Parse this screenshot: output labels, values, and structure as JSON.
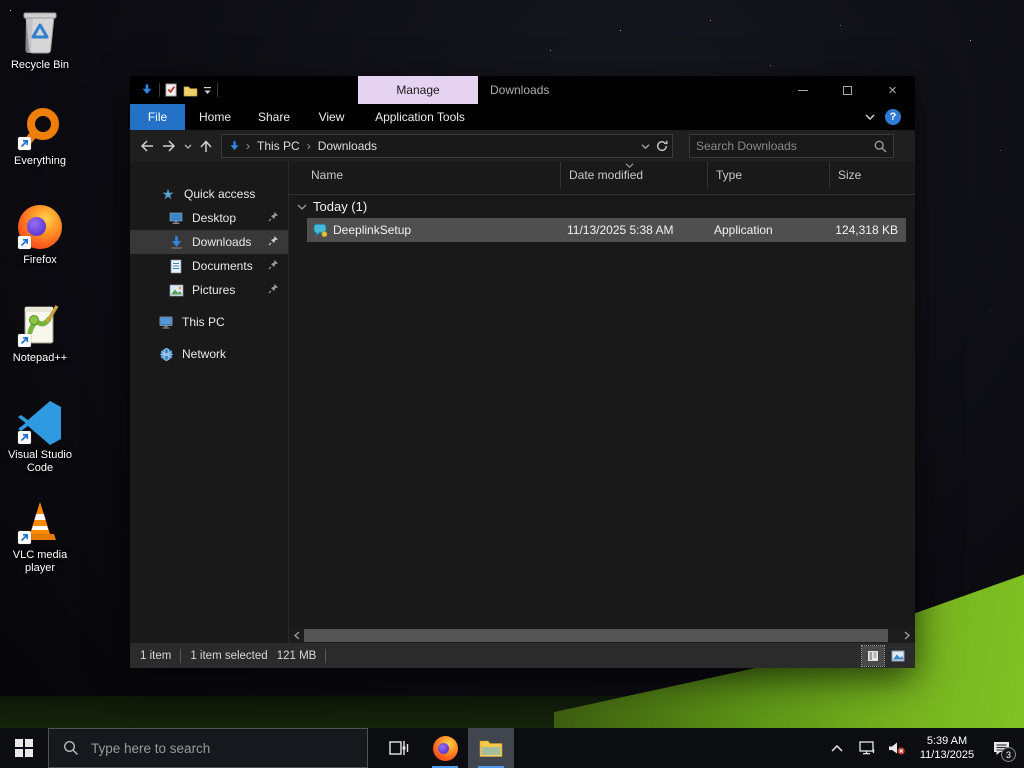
{
  "colors": {
    "accent_blue": "#2472c8",
    "manage_tab_bg": "#e5d3f1",
    "selection_gray": "#4f4f4f",
    "taskbar_underline": "#4f9cf0",
    "hill_green": "#76b31f"
  },
  "desktop": {
    "icons": [
      {
        "label": "Recycle Bin"
      },
      {
        "label": "Everything"
      },
      {
        "label": "Firefox"
      },
      {
        "label": "Notepad++"
      },
      {
        "label": "Visual Studio Code"
      },
      {
        "label": "VLC media player"
      }
    ]
  },
  "window": {
    "title": "Downloads",
    "contextual_tab_label": "Manage",
    "tabs": {
      "file": "File",
      "home": "Home",
      "share": "Share",
      "view": "View",
      "contextual": "Application Tools"
    },
    "address": {
      "crumb_root": "This PC",
      "crumb_current": "Downloads",
      "separator": "›"
    },
    "search": {
      "placeholder": "Search Downloads"
    },
    "nav": {
      "quick_access": "Quick access",
      "desktop": "Desktop",
      "downloads": "Downloads",
      "documents": "Documents",
      "pictures": "Pictures",
      "this_pc": "This PC",
      "network": "Network"
    },
    "list": {
      "columns": {
        "name": "Name",
        "date": "Date modified",
        "type": "Type",
        "size": "Size"
      },
      "group_label": "Today (1)",
      "rows": [
        {
          "name": "DeeplinkSetup",
          "date_modified": "11/13/2025 5:38 AM",
          "type": "Application",
          "size": "124,318 KB"
        }
      ]
    },
    "status_bar": {
      "items": "1 item",
      "selected": "1 item selected",
      "selected_size": "121 MB"
    }
  },
  "taskbar": {
    "search_placeholder": "Type here to search",
    "clock_time": "5:39 AM",
    "clock_date": "11/13/2025",
    "notification_badge": "3"
  }
}
